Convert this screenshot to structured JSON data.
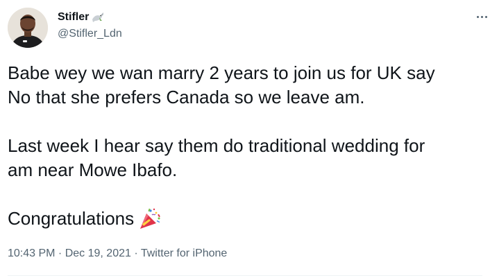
{
  "author": {
    "display_name": "Stifler",
    "name_emoji": "dove-emoji",
    "handle": "@Stifler_Ldn"
  },
  "tweet": {
    "line1": "Babe wey we wan marry 2 years to join us for UK say",
    "line2": "No that she prefers Canada so we leave am.",
    "line3": "Last week I hear say them do traditional wedding for",
    "line4": "am near Mowe Ibafo.",
    "line5": "Congratulations",
    "line5_emoji": "party-popper-emoji"
  },
  "meta": {
    "time": "10:43 PM",
    "separator1": " · ",
    "date": "Dec 19, 2021",
    "separator2": " · ",
    "source": "Twitter for iPhone"
  },
  "icons": {
    "more": "more-icon"
  },
  "colors": {
    "text_primary": "#0f1419",
    "text_secondary": "#536471",
    "divider": "#eff3f4"
  }
}
